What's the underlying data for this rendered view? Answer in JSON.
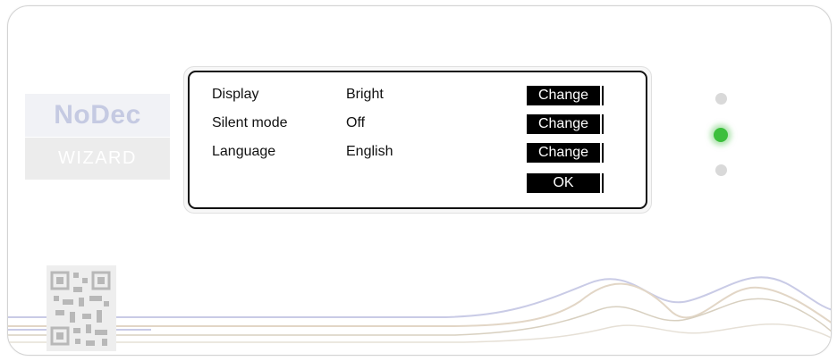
{
  "logo": {
    "brand": "NoDec",
    "subtitle": "WIZARD"
  },
  "settings": [
    {
      "label": "Display",
      "value": "Bright",
      "button": "Change"
    },
    {
      "label": "Silent mode",
      "value": "Off",
      "button": "Change"
    },
    {
      "label": "Language",
      "value": "English",
      "button": "Change"
    }
  ],
  "ok_label": "OK",
  "status_leds": [
    {
      "state": "off",
      "color": "#d9d9d9"
    },
    {
      "state": "on",
      "color": "#3cbf3c"
    },
    {
      "state": "off",
      "color": "#d9d9d9"
    }
  ],
  "icons": {
    "qr": "qr-code-icon"
  }
}
